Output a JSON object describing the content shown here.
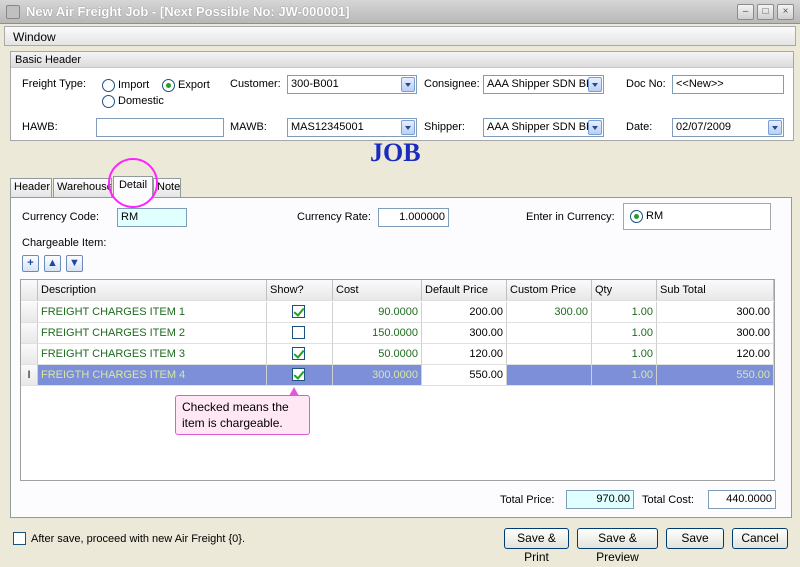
{
  "window": {
    "title": "New Air Freight Job  - [Next Possible No: JW-000001]",
    "menu": [
      "Window"
    ]
  },
  "basic_header": {
    "title": "Basic Header",
    "freight_type_label": "Freight Type:",
    "freight_options": [
      {
        "label": "Import",
        "selected": false
      },
      {
        "label": "Export",
        "selected": true
      },
      {
        "label": "Domestic",
        "selected": false
      }
    ],
    "customer_label": "Customer:",
    "customer_value": "300-B001",
    "consignee_label": "Consignee:",
    "consignee_value": "AAA Shipper SDN BHD",
    "doc_no_label": "Doc No:",
    "doc_no_value": "<<New>>",
    "hawb_label": "HAWB:",
    "hawb_value": "",
    "mawb_label": "MAWB:",
    "mawb_value": "MAS12345001",
    "shipper_label": "Shipper:",
    "shipper_value": "AAA Shipper SDN BHD",
    "date_label": "Date:",
    "date_value": "02/07/2009"
  },
  "banner": "JOB",
  "tabs": [
    {
      "label": "Header",
      "active": false
    },
    {
      "label": "Warehouse",
      "active": false
    },
    {
      "label": "Detail",
      "active": true
    },
    {
      "label": "Note",
      "active": false
    }
  ],
  "detail": {
    "currency_code_label": "Currency Code:",
    "currency_code_value": "RM",
    "currency_rate_label": "Currency Rate:",
    "currency_rate_value": "1.000000",
    "enter_in_currency_label": "Enter in Currency:",
    "enter_in_currency_option": "RM",
    "chargeable_item_label": "Chargeable Item:",
    "toolbar_icons": [
      "add-icon",
      "move-up-icon",
      "move-down-icon"
    ]
  },
  "grid": {
    "columns": [
      "Description",
      "Show?",
      "Cost",
      "Default Price",
      "Custom Price",
      "Qty",
      "Sub Total"
    ],
    "rows": [
      {
        "indicator": "",
        "description": "FREIGHT CHARGES ITEM 1",
        "show": true,
        "cost": "90.0000",
        "default_price": "200.00",
        "custom_price": "300.00",
        "qty": "1.00",
        "sub_total": "300.00",
        "selected": false
      },
      {
        "indicator": "",
        "description": "FREIGHT CHARGES ITEM 2",
        "show": false,
        "cost": "150.0000",
        "default_price": "300.00",
        "custom_price": "",
        "qty": "1.00",
        "sub_total": "300.00",
        "selected": false
      },
      {
        "indicator": "",
        "description": "FREIGHT CHARGES ITEM 3",
        "show": true,
        "cost": "50.0000",
        "default_price": "120.00",
        "custom_price": "",
        "qty": "1.00",
        "sub_total": "120.00",
        "selected": false
      },
      {
        "indicator": "I",
        "description": "FREIGTH CHARGES ITEM 4",
        "show": true,
        "cost": "300.0000",
        "default_price": "550.00",
        "custom_price": "",
        "qty": "1.00",
        "sub_total": "550.00",
        "selected": true
      }
    ]
  },
  "callout": "Checked means the item is chargeable.",
  "totals": {
    "total_price_label": "Total Price:",
    "total_price_value": "970.00",
    "total_cost_label": "Total Cost:",
    "total_cost_value": "440.0000"
  },
  "footer": {
    "proceed_label": "After save, proceed with new Air Freight {0}.",
    "proceed_checked": false,
    "save_print": "Save & Print",
    "save_preview": "Save & Preview",
    "save": "Save",
    "cancel": "Cancel"
  }
}
